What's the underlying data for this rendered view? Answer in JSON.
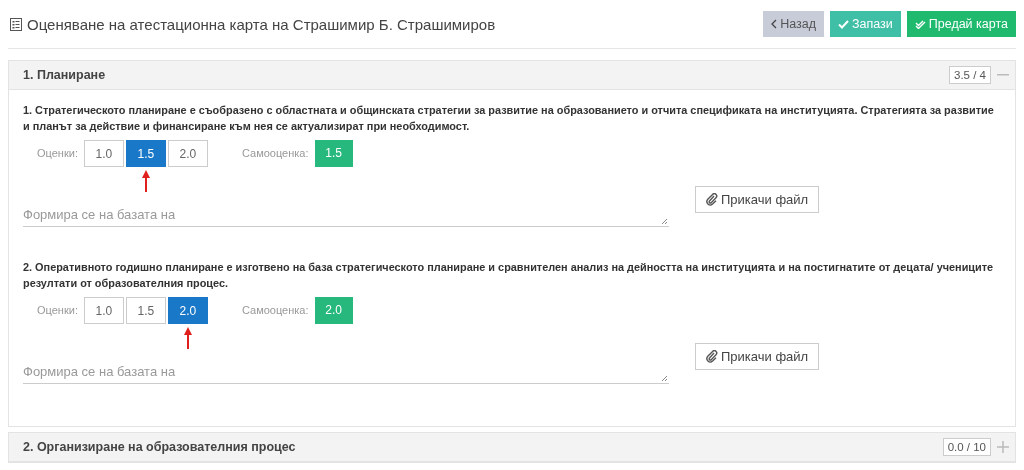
{
  "page": {
    "title": "Оценяване на атестационна карта на Страшимир Б. Страшимиров"
  },
  "actions": [
    {
      "label": "Назад",
      "kind": "back"
    },
    {
      "label": "Запази",
      "kind": "save"
    },
    {
      "label": "Предай карта",
      "kind": "submit"
    }
  ],
  "sections": [
    {
      "title": "1. Планиране",
      "score": "3.5 / 4",
      "expanded": true,
      "criteria": [
        {
          "text": "1. Стратегическото планиране е съобразено с областната и общинската стратегии за развитие на образованието и отчита спецификата на институцията. Стратегията за развитие и планът за действие и финансиране към нея се актуализират при необходимост.",
          "grades_label": "Оценки:",
          "grades": [
            {
              "label": "1.0",
              "selected": false
            },
            {
              "label": "1.5",
              "selected": true
            },
            {
              "label": "2.0",
              "selected": false
            }
          ],
          "self_label": "Самооценка:",
          "self_score": "1.5",
          "placeholder": "Формира се на базата на",
          "attach": "Прикачи файл"
        },
        {
          "text": "2. Оперативното годишно планиране е изготвено на база стратегическото планиране и сравнителен анализ на дейността на институцията и на постигнатите от децата/ учениците резултати от образователния процес.",
          "grades_label": "Оценки:",
          "grades": [
            {
              "label": "1.0",
              "selected": false
            },
            {
              "label": "1.5",
              "selected": false
            },
            {
              "label": "2.0",
              "selected": true
            }
          ],
          "self_label": "Самооценка:",
          "self_score": "2.0",
          "placeholder": "Формира се на базата на",
          "attach": "Прикачи файл"
        }
      ]
    },
    {
      "title": "2. Организиране на образователния процес",
      "score": "0.0 / 10",
      "expanded": false
    }
  ]
}
